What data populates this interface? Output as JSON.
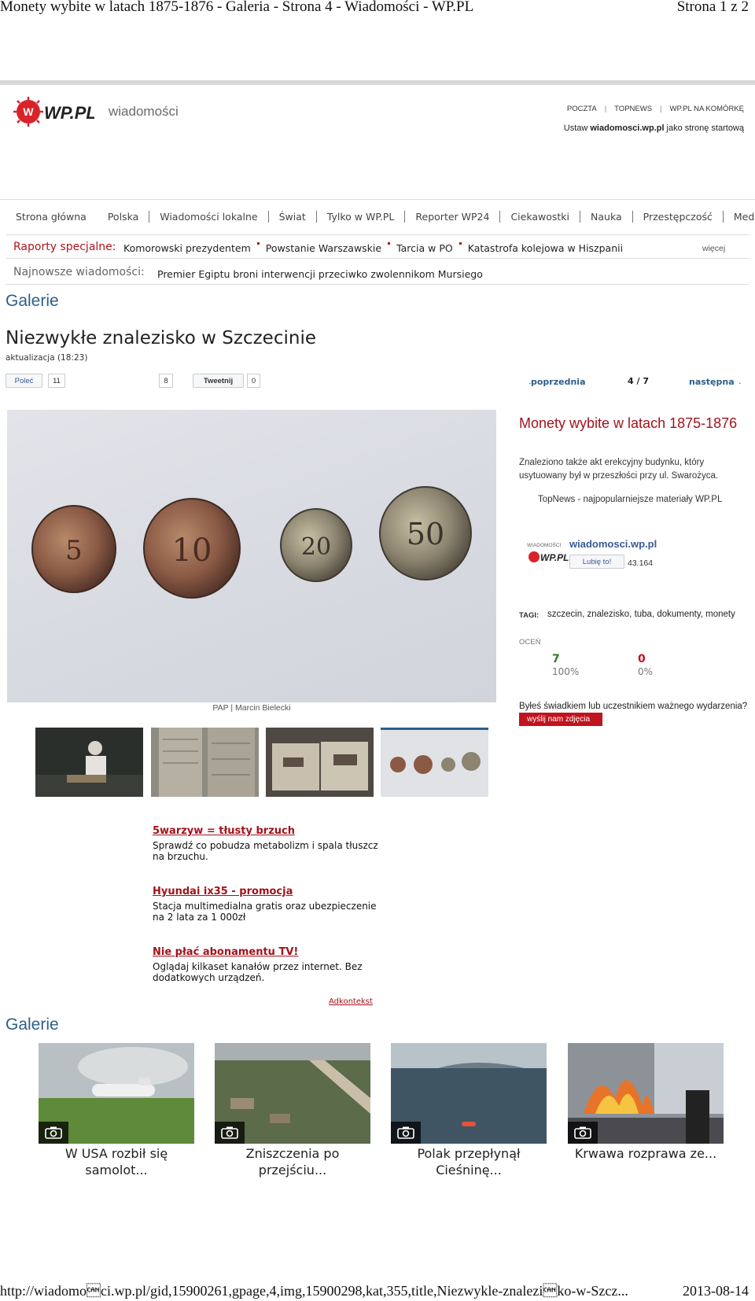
{
  "print": {
    "title": "Monety wybite w latach 1875-1876 - Galeria - Strona 4 - Wiadomości - WP.PL",
    "page": "Strona 1 z 2",
    "url": "http://wiadomo\u0018ci.wp.pl/gid,15900261,gpage,4,img,15900298,kat,355,title,Niezwykle-znalezi\u0018ko-w-Szcz...",
    "date": "2013-08-14"
  },
  "header": {
    "logo_text": "WP.PL",
    "section": "wiadomości",
    "top_links": [
      "POCZTA",
      "TOPNEWS",
      "WP.PL NA KOMÓRKĘ"
    ],
    "homepage_prefix": "Ustaw ",
    "homepage_site": "wiadomosci.wp.pl",
    "homepage_suffix": " jako stronę startową"
  },
  "nav": {
    "items": [
      "Strona główna",
      "Polska",
      "Wiadomości lokalne",
      "Świat",
      "Tylko w WP.PL",
      "Reporter WP24",
      "Ciekawostki",
      "Nauka",
      "Przestępczość",
      "Media"
    ]
  },
  "reports": {
    "label": "Raporty specjalne:",
    "items": [
      "Komorowski prezydentem",
      "Powstanie Warszawskie",
      "Tarcia w PO",
      "Katastrofa kolejowa w Hiszpanii"
    ],
    "more": "więcej"
  },
  "latest": {
    "label": "Najnowsze wiadomości:",
    "text": "Premier Egiptu broni interwencji przeciwko zwolennikom Mursiego"
  },
  "gallery_heading": "Galerie",
  "article": {
    "title": "Niezwykłe znalezisko w Szczecinie",
    "update": "aktualizacja (18:23)"
  },
  "social": {
    "polec_label": "Poleć",
    "polec_count": "11",
    "plus_count": "8",
    "tweet_label": "Tweetnij",
    "tweet_count": "0"
  },
  "pager": {
    "prev": "poprzednia",
    "count": "4 / 7",
    "next": "następna",
    "dot": "."
  },
  "photo": {
    "caption": "PAP | Marcin Bielecki",
    "coins": [
      "5",
      "10",
      "20",
      "50"
    ]
  },
  "side": {
    "title": "Monety wybite w latach 1875-1876",
    "description": "Znaleziono także akt erekcyjny budynku, który usytuowany był w przeszłości przy ul. Swarożyca.",
    "topnews": "TopNews - najpopularniejsze materiały WP.PL",
    "fb_logo_small": "WIADOMOŚCI",
    "fb_logo_big": "WP.PL",
    "fb_site": "wiadomosci.wp.pl",
    "fb_like": "Lubię to!",
    "fb_count": "43.164",
    "tags_label": "TAGI:",
    "tags": "szczecin, znalezisko, tuba, dokumenty, monety",
    "rate_label": "OCEŃ",
    "rate_up": "7",
    "rate_up_pct": "100%",
    "rate_down": "0",
    "rate_down_pct": "0%",
    "witness": "Byłeś świadkiem lub uczestnikiem ważnego wydarzenia?",
    "witness_button": "wyślij nam zdjęcia"
  },
  "ads": [
    {
      "title": "5warzyw = tłusty brzuch",
      "desc": "Sprawdź co pobudza metabolizm i spala tłuszcz na brzuchu."
    },
    {
      "title": "Hyundai ix35 - promocja",
      "desc": "Stacja multimedialna gratis oraz ubezpieczenie na 2 lata za 1 000zł"
    },
    {
      "title": "Nie płać abonamentu TV!",
      "desc": "Oglądaj kilkaset kanałów przez internet. Bez dodatkowych urządzeń."
    }
  ],
  "adkontekst": "Adkontekst",
  "gallery_cards": [
    {
      "label": "W USA rozbił się samolot..."
    },
    {
      "label": "Zniszczenia po przejściu..."
    },
    {
      "label": "Polak przepłynął Cieśninę..."
    },
    {
      "label": "Krwawa rozprawa ze..."
    }
  ],
  "colors": {
    "brand_red": "#a3121c",
    "link_blue": "#2c5f8a",
    "rate_green": "#2e7d1f"
  }
}
